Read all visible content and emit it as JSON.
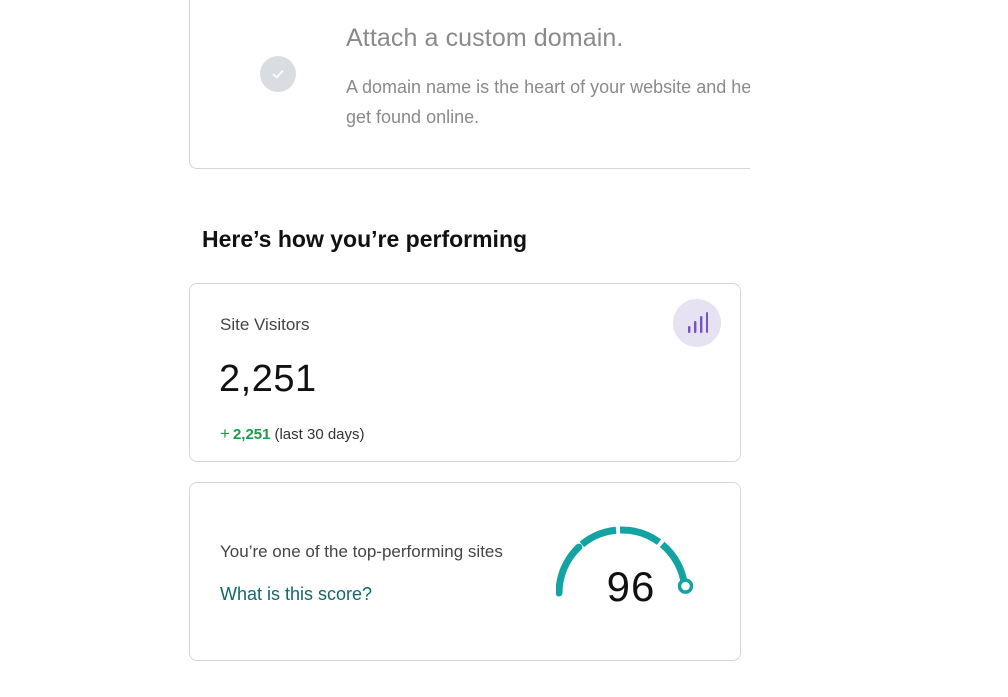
{
  "domain_step": {
    "title": "Attach a custom domain.",
    "description_line1": "A domain name is the heart of your website and helps you",
    "description_line2": "get found online.",
    "icon": "check-icon"
  },
  "performance": {
    "heading": "Here’s how you’re performing",
    "visitors": {
      "label": "Site Visitors",
      "value": "2,251",
      "change_sign": "+",
      "change_value": "2,251",
      "change_period": "(last 30 days)",
      "icon": "bar-chart-icon"
    },
    "score": {
      "text": "You’re one of the top-performing sites",
      "link": "What is this score?",
      "value": "96",
      "gauge_fraction": 0.96,
      "gauge_color": "#13a3a3"
    }
  },
  "colors": {
    "accent_teal": "#13a3a3",
    "link_teal": "#12676d",
    "positive_green": "#1e9b4a",
    "badge_purple": "#7a52c7"
  }
}
